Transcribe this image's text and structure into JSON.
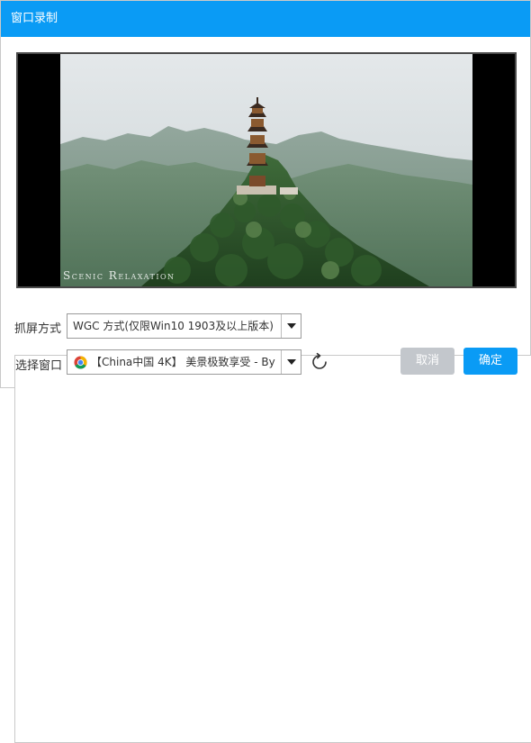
{
  "window": {
    "title": "窗口录制"
  },
  "preview": {
    "watermark": "Scenic Relaxation"
  },
  "capture_mode": {
    "label": "抓屏方式",
    "value": "WGC 方式(仅限Win10 1903及以上版本)"
  },
  "window_select": {
    "label": "选择窗口",
    "value": "【China中国 4K】 美景极致享受 - By",
    "icon": "chrome-icon"
  },
  "refresh": {
    "icon": "refresh-icon"
  },
  "buttons": {
    "cancel": "取消",
    "ok": "确定"
  },
  "colors": {
    "titlebar": "#0a9bf5",
    "ok_button": "#0a9bf5",
    "cancel_button": "#c3c7cc"
  }
}
